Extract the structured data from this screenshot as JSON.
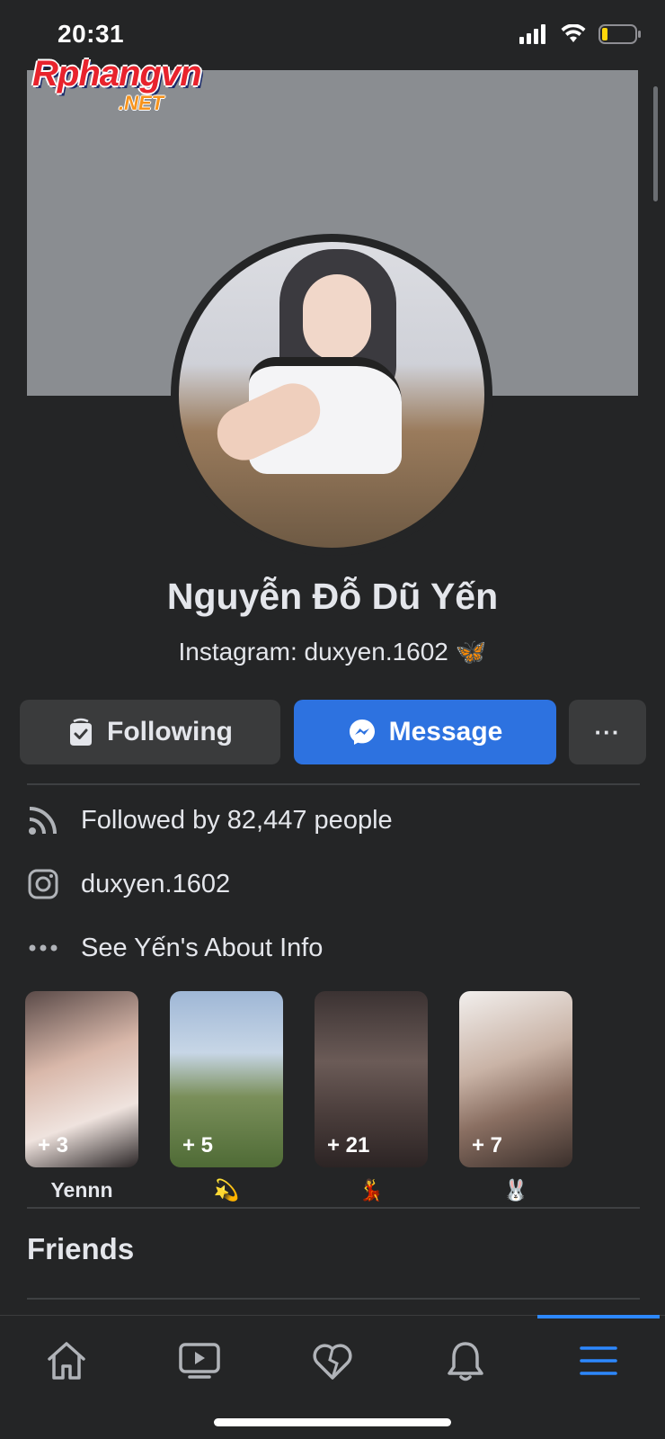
{
  "status_bar": {
    "time": "20:31"
  },
  "watermark": {
    "main": "Rphangvn",
    "sub": ".NET"
  },
  "profile": {
    "name": "Nguyễn Đỗ Dũ Yến",
    "bio": "Instagram: duxyen.1602 🦋"
  },
  "actions": {
    "following_label": "Following",
    "message_label": "Message",
    "more_label": "···"
  },
  "info": {
    "followers": "Followed by 82,447 people",
    "instagram": "duxyen.1602",
    "about": "See Yến's About Info"
  },
  "highlights": [
    {
      "count": "+ 3",
      "label": "Yennn"
    },
    {
      "count": "+ 5",
      "label": "💫"
    },
    {
      "count": "+ 21",
      "label": "💃"
    },
    {
      "count": "+ 7",
      "label": "🐰"
    }
  ],
  "sections": {
    "friends": "Friends"
  },
  "tabs": [
    {
      "icon": "home-icon"
    },
    {
      "icon": "video-icon"
    },
    {
      "icon": "dating-heart-icon"
    },
    {
      "icon": "bell-icon"
    },
    {
      "icon": "menu-icon",
      "active": true
    }
  ],
  "colors": {
    "accent": "#2d72e0",
    "background": "#242526",
    "button": "#3a3b3c",
    "tab_active": "#2d88ff"
  }
}
